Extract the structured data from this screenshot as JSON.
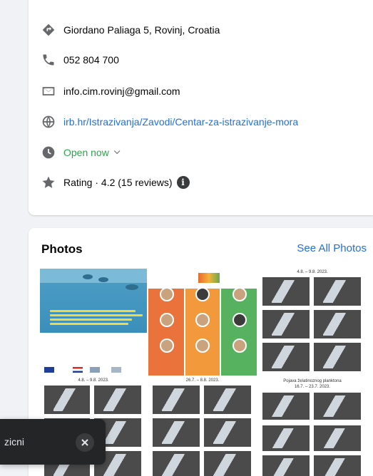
{
  "about": {
    "address": "Giordano Paliaga 5, Rovinj, Croatia",
    "phone": "052 804 700",
    "email": "info.cim.rovinj@gmail.com",
    "website": "irb.hr/Istrazivanja/Zavodi/Centar-za-istrazivanje-mora",
    "hours_status": "Open now",
    "rating": "Rating · 4.2 (15 reviews)",
    "info_glyph": "i",
    "icons": [
      "directions-icon",
      "phone-icon",
      "mail-icon",
      "globe-icon",
      "clock-icon",
      "star-icon",
      "info-icon"
    ]
  },
  "photos": {
    "title": "Photos",
    "see_all": "See All Photos",
    "map_headers": [
      "4.8. – 9.8. 2023.",
      "4.8. – 9.8. 2023.",
      "26.7. – 8.8. 2023.",
      "Pojava želatinoznog planktona\n16.7. – 23.7. 2023."
    ]
  },
  "toast": {
    "text": "zicni"
  },
  "colors": {
    "accent": "#216fdb",
    "open_green": "#31a24c",
    "icon_grey": "#65676b",
    "page_bg": "#f0f2f5"
  }
}
